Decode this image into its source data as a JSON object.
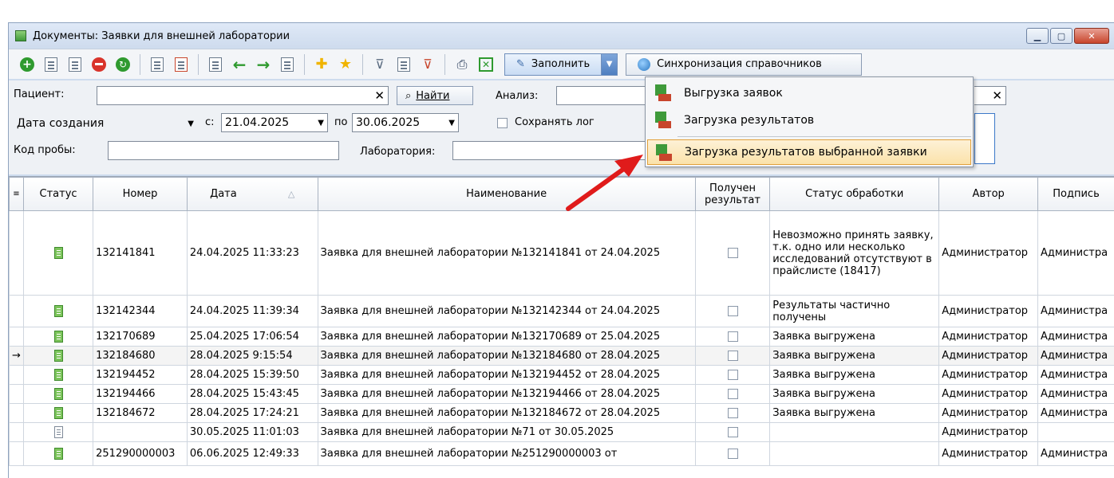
{
  "window": {
    "title": "Документы: Заявки для внешней лаборатории",
    "buttons": [
      "minimize",
      "maximize",
      "close"
    ]
  },
  "toolbar": {
    "fill_label": "Заполнить",
    "sync_label": "Синхронизация справочников"
  },
  "filters": {
    "patient_label": "Пациент:",
    "patient_value": "",
    "find_label": "Найти",
    "analysis_label": "Анализ:",
    "date_type": "Дата создания",
    "from_label": "с:",
    "from_date": "21.04.2025",
    "to_label": "по",
    "to_date": "30.06.2025",
    "save_log_label": "Сохранять лог",
    "sample_code_label": "Код пробы:",
    "lab_label": "Лаборатория:"
  },
  "menu": {
    "items": [
      {
        "label": "Выгрузка заявок"
      },
      {
        "label": "Загрузка результатов"
      },
      {
        "label": "Загрузка результатов выбранной заявки"
      }
    ]
  },
  "table": {
    "headers": [
      "Статус",
      "Номер",
      "Дата",
      "Наименование",
      "Получен результат",
      "Статус обработки",
      "Автор",
      "Подпись"
    ],
    "rows": [
      {
        "status": "green",
        "number": "132141841",
        "date": "24.04.2025 11:33:23",
        "name": "Заявка для внешней лаборатории №132141841 от 24.04.2025",
        "proc": "Невозможно принять заявку, т.к. одно или несколько исследований отсутствуют в прайслисте (18417)",
        "author": "Администратор",
        "sign": "Администра"
      },
      {
        "status": "green",
        "number": "132142344",
        "date": "24.04.2025 11:39:34",
        "name": "Заявка для внешней лаборатории №132142344 от 24.04.2025",
        "proc": "Результаты частично получены",
        "author": "Администратор",
        "sign": "Администра"
      },
      {
        "status": "green",
        "number": "132170689",
        "date": "25.04.2025 17:06:54",
        "name": "Заявка для внешней лаборатории №132170689 от 25.04.2025",
        "proc": "Заявка выгружена",
        "author": "Администратор",
        "sign": "Администра"
      },
      {
        "status": "green",
        "number": "132184680",
        "date": "28.04.2025 9:15:54",
        "name": "Заявка для внешней лаборатории №132184680 от 28.04.2025",
        "proc": "Заявка выгружена",
        "author": "Администратор",
        "sign": "Администра"
      },
      {
        "status": "green",
        "number": "132194452",
        "date": "28.04.2025 15:39:50",
        "name": "Заявка для внешней лаборатории №132194452 от 28.04.2025",
        "proc": "Заявка выгружена",
        "author": "Администратор",
        "sign": "Администра"
      },
      {
        "status": "green",
        "number": "132194466",
        "date": "28.04.2025 15:43:45",
        "name": "Заявка для внешней лаборатории №132194466 от 28.04.2025",
        "proc": "Заявка выгружена",
        "author": "Администратор",
        "sign": "Администра"
      },
      {
        "status": "green",
        "number": "132184672",
        "date": "28.04.2025 17:24:21",
        "name": "Заявка для внешней лаборатории №132184672 от 28.04.2025",
        "proc": "Заявка выгружена",
        "author": "Администратор",
        "sign": "Администра"
      },
      {
        "status": "empty",
        "number": "",
        "date": "30.05.2025 11:01:03",
        "name": "Заявка для внешней лаборатории №71 от 30.05.2025",
        "proc": "",
        "author": "Администратор",
        "sign": ""
      },
      {
        "status": "green",
        "number": "251290000003",
        "date": "06.06.2025 12:49:33",
        "name": "Заявка для внешней лаборатории №251290000003 от",
        "proc": "",
        "author": "Администратор",
        "sign": "Администра"
      }
    ]
  }
}
